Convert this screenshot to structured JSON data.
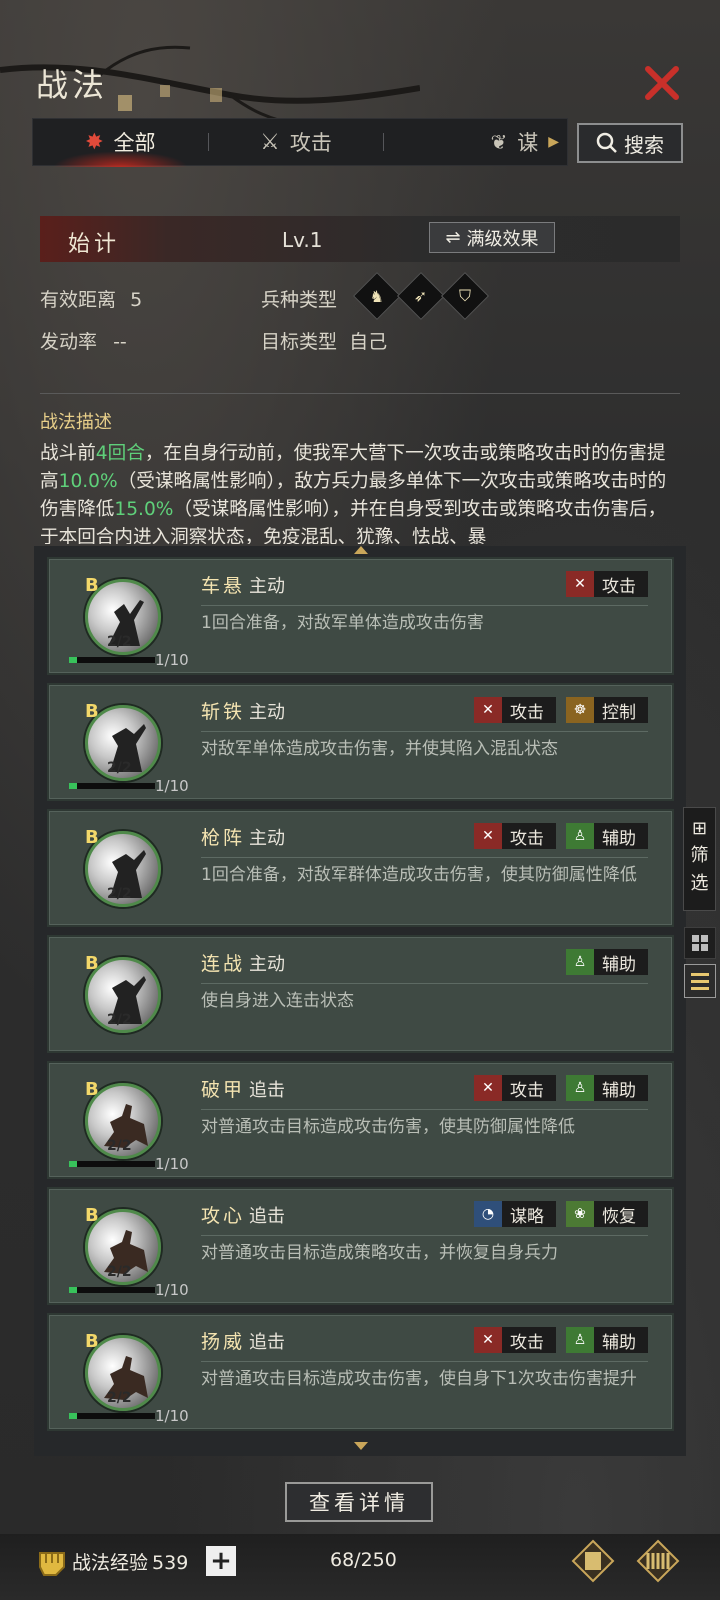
{
  "header": {
    "title": "战法"
  },
  "tabs": [
    {
      "label": "全部",
      "icon": "bundle-icon"
    },
    {
      "label": "攻击",
      "icon": "crossed-swords-icon"
    },
    {
      "label": "谋",
      "icon": "fan-icon"
    }
  ],
  "search": {
    "label": "搜索",
    "icon": "search-icon"
  },
  "skill": {
    "name": "始计",
    "level": "Lv.1",
    "max_effect_label": "满级效果",
    "range_label": "有效距离",
    "range_value": "5",
    "troop_type_label": "兵种类型",
    "troop_types": [
      "cavalry-icon",
      "archer-icon",
      "shield-icon"
    ],
    "rate_label": "发动率",
    "rate_value": "--",
    "target_label": "目标类型",
    "target_value": "自己",
    "desc_title": "战法描述",
    "desc": [
      "战斗前",
      "4回合",
      "，在自身行动前，使我军大营下一次攻击或策略攻击时的伤害提高",
      "10.0%",
      "（受谋略属性影响），敌方兵力最多单体下一次攻击或策略攻击时的伤害降低",
      "15.0%",
      "（受谋略属性影响），并在自身受到攻击或策略攻击伤害后，于本回合内进入",
      "洞察",
      "状态，免疫",
      "混乱",
      "、",
      "犹豫",
      "、",
      "怯战",
      "、",
      "暴"
    ]
  },
  "skills": [
    {
      "name": "车悬",
      "type": "主动",
      "grade": "B",
      "count": "2/2",
      "progress": "1/10",
      "desc": "1回合准备，对敌军单体造成攻击伤害",
      "tags": [
        "攻击"
      ]
    },
    {
      "name": "斩铁",
      "type": "主动",
      "grade": "B",
      "count": "2/2",
      "progress": "1/10",
      "desc": "对敌军单体造成攻击伤害，并使其陷入混乱状态",
      "tags": [
        "攻击",
        "控制"
      ]
    },
    {
      "name": "枪阵",
      "type": "主动",
      "grade": "B",
      "count": "2/2",
      "desc": "1回合准备，对敌军群体造成攻击伤害，使其防御属性降低",
      "tags": [
        "攻击",
        "辅助"
      ]
    },
    {
      "name": "连战",
      "type": "主动",
      "grade": "B",
      "count": "2/2",
      "desc": "使自身进入连击状态",
      "tags": [
        "辅助"
      ]
    },
    {
      "name": "破甲",
      "type": "追击",
      "grade": "B",
      "count": "2/2",
      "progress": "1/10",
      "desc": "对普通攻击目标造成攻击伤害，使其防御属性降低",
      "tags": [
        "攻击",
        "辅助"
      ]
    },
    {
      "name": "攻心",
      "type": "追击",
      "grade": "B",
      "count": "2/2",
      "progress": "1/10",
      "desc": "对普通攻击目标造成策略攻击，并恢复自身兵力",
      "tags": [
        "谋略",
        "恢复"
      ]
    },
    {
      "name": "扬威",
      "type": "追击",
      "grade": "B",
      "count": "2/2",
      "progress": "1/10",
      "desc": "对普通攻击目标造成攻击伤害，使自身下1次攻击伤害提升",
      "tags": [
        "攻击",
        "辅助"
      ]
    }
  ],
  "side": {
    "filter_1": "筛",
    "filter_2": "选"
  },
  "footer": {
    "detail_label": "查看详情",
    "exp_label": "战法经验",
    "exp_value": "539",
    "plus": "+",
    "count": "68/250"
  },
  "colors": {
    "accent_red": "#c8302a",
    "highlight_green": "#5fd07a",
    "gold": "#e8cf8a",
    "card_bg": "#3f4a44"
  }
}
